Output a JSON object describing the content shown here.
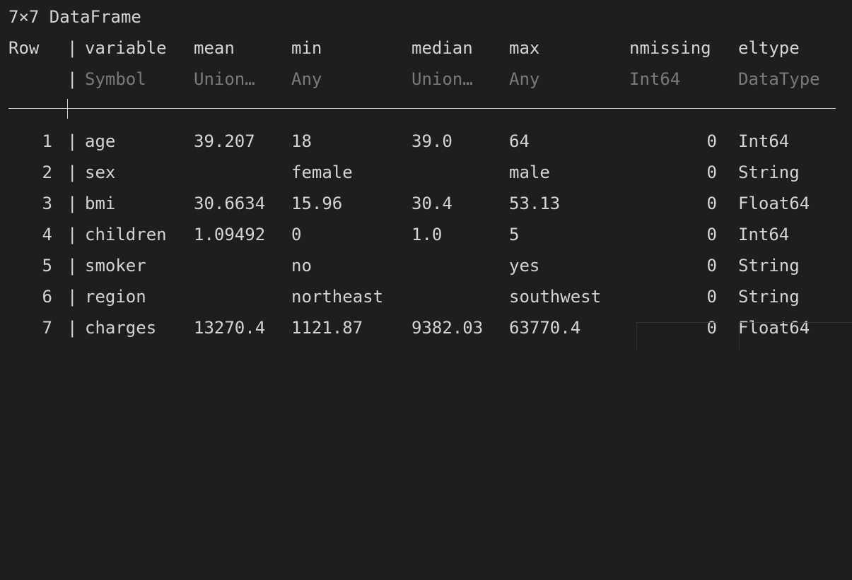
{
  "title": "7×7 DataFrame",
  "header": {
    "row": "Row",
    "columns": [
      {
        "name": "variable",
        "type": "Symbol"
      },
      {
        "name": "mean",
        "type": "Union…"
      },
      {
        "name": "min",
        "type": "Any"
      },
      {
        "name": "median",
        "type": "Union…"
      },
      {
        "name": "max",
        "type": "Any"
      },
      {
        "name": "nmissing",
        "type": "Int64"
      },
      {
        "name": "eltype",
        "type": "DataType"
      }
    ]
  },
  "rows": [
    {
      "row": "1",
      "variable": "age",
      "mean": "39.207",
      "min": "18",
      "median": "39.0",
      "max": "64",
      "nmissing": "0",
      "eltype": "Int64"
    },
    {
      "row": "2",
      "variable": "sex",
      "mean": "",
      "min": "female",
      "median": "",
      "max": "male",
      "nmissing": "0",
      "eltype": "String"
    },
    {
      "row": "3",
      "variable": "bmi",
      "mean": "30.6634",
      "min": "15.96",
      "median": "30.4",
      "max": "53.13",
      "nmissing": "0",
      "eltype": "Float64"
    },
    {
      "row": "4",
      "variable": "children",
      "mean": "1.09492",
      "min": "0",
      "median": "1.0",
      "max": "5",
      "nmissing": "0",
      "eltype": "Int64"
    },
    {
      "row": "5",
      "variable": "smoker",
      "mean": "",
      "min": "no",
      "median": "",
      "max": "yes",
      "nmissing": "0",
      "eltype": "String"
    },
    {
      "row": "6",
      "variable": "region",
      "mean": "",
      "min": "northeast",
      "median": "",
      "max": "southwest",
      "nmissing": "0",
      "eltype": "String"
    },
    {
      "row": "7",
      "variable": "charges",
      "mean": "13270.4",
      "min": "1121.87",
      "median": "9382.03",
      "max": "63770.4",
      "nmissing": "0",
      "eltype": "Float64"
    }
  ],
  "divider": "|"
}
